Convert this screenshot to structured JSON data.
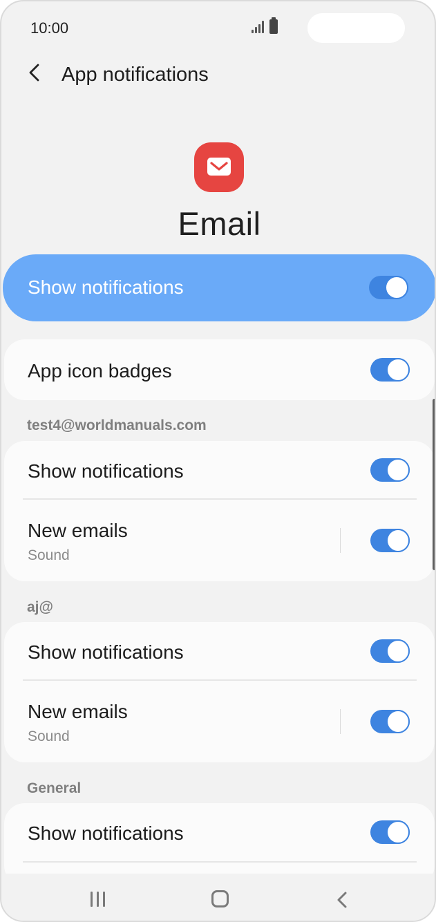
{
  "status_bar": {
    "time": "10:00"
  },
  "header": {
    "title": "App notifications"
  },
  "app": {
    "name": "Email",
    "icon_color": "#e64541"
  },
  "master_toggle": {
    "label": "Show notifications",
    "enabled": true,
    "bg_color": "#6aaaf8"
  },
  "badges": {
    "label": "App icon badges",
    "enabled": true
  },
  "accounts": [
    {
      "section": "test4@worldmanuals.com",
      "show_notifications": {
        "label": "Show notifications",
        "enabled": true
      },
      "new_emails": {
        "label": "New emails",
        "sub": "Sound",
        "enabled": true
      }
    },
    {
      "section": "aj@",
      "show_notifications": {
        "label": "Show notifications",
        "enabled": true
      },
      "new_emails": {
        "label": "New emails",
        "sub": "Sound",
        "enabled": true
      }
    }
  ],
  "general": {
    "section": "General",
    "show_notifications": {
      "label": "Show notifications",
      "enabled": true
    }
  },
  "accent_color": "#3e84e0",
  "nav_bar": {
    "icons": [
      "recents-icon",
      "home-icon",
      "back-icon"
    ]
  }
}
